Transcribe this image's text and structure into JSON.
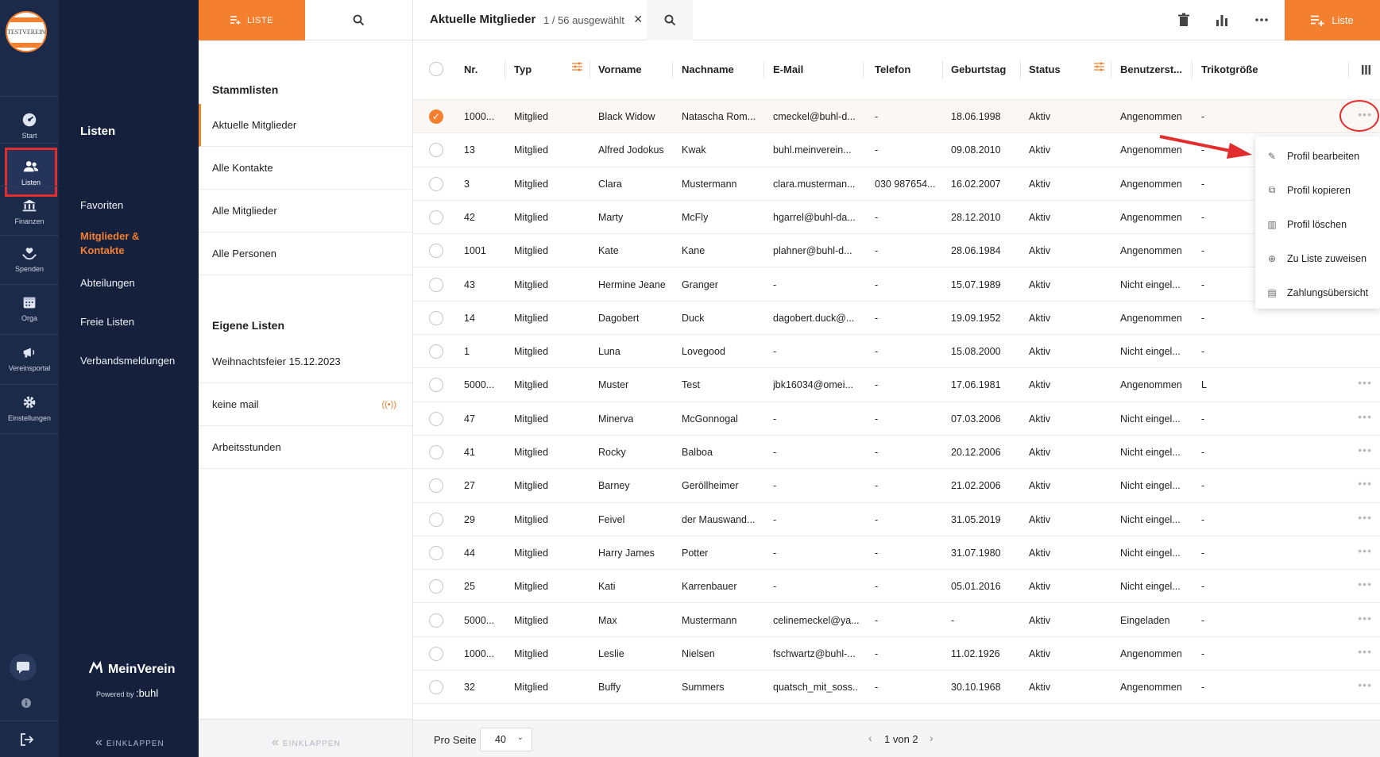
{
  "club_logo_text": "TESTVEREIN",
  "rail": {
    "items": [
      {
        "label": "Start",
        "icon": "dashboard-icon"
      },
      {
        "label": "Listen",
        "icon": "users-icon"
      },
      {
        "label": "Finanzen",
        "icon": "bank-icon"
      },
      {
        "label": "Spenden",
        "icon": "donation-icon"
      },
      {
        "label": "Orga",
        "icon": "calendar-icon"
      },
      {
        "label": "Vereinsportal",
        "icon": "megaphone-icon"
      },
      {
        "label": "Einstellungen",
        "icon": "gear-icon"
      }
    ]
  },
  "nav": {
    "title": "Listen",
    "items": [
      "Favoriten",
      "Mitglieder & Kontakte",
      "Abteilungen",
      "Freie Listen",
      "Verbandsmeldungen"
    ],
    "brand": "MeinVerein",
    "powered_prefix": "Powered by",
    "powered_brand": ":buhl",
    "collapse": "EINKLAPPEN"
  },
  "lists": {
    "tab_label": "LISTE",
    "section1": "Stammlisten",
    "stamm": [
      "Aktuelle Mitglieder",
      "Alle Kontakte",
      "Alle Mitglieder",
      "Alle Personen"
    ],
    "section2": "Eigene Listen",
    "eigene": [
      "Weihnachtsfeier 15.12.2023",
      "keine mail",
      "Arbeitsstunden"
    ],
    "broadcast_symbol": "((•))",
    "collapse": "EINKLAPPEN"
  },
  "main": {
    "title": "Aktuelle Mitglieder",
    "selection": "1 / 56 ausgewählt",
    "new_list_label": "Liste",
    "columns": [
      "Nr.",
      "Typ",
      "Vorname",
      "Nachname",
      "E-Mail",
      "Telefon",
      "Geburtstag",
      "Status",
      "Benutzerst...",
      "Trikotgröße"
    ],
    "rows": [
      [
        "1000...",
        "Mitglied",
        "Black Widow",
        "Natascha Rom...",
        "cmeckel@buhl-d...",
        "-",
        "18.06.1998",
        "Aktiv",
        "Angenommen",
        "-"
      ],
      [
        "13",
        "Mitglied",
        "Alfred Jodokus",
        "Kwak",
        "buhl.meinverein...",
        "-",
        "09.08.2010",
        "Aktiv",
        "Angenommen",
        "-"
      ],
      [
        "3",
        "Mitglied",
        "Clara",
        "Mustermann",
        "clara.musterman...",
        "030 987654...",
        "16.02.2007",
        "Aktiv",
        "Angenommen",
        "-"
      ],
      [
        "42",
        "Mitglied",
        "Marty",
        "McFly",
        "hgarrel@buhl-da...",
        "-",
        "28.12.2010",
        "Aktiv",
        "Angenommen",
        "-"
      ],
      [
        "1001",
        "Mitglied",
        "Kate",
        "Kane",
        "plahner@buhl-d...",
        "-",
        "28.06.1984",
        "Aktiv",
        "Angenommen",
        "-"
      ],
      [
        "43",
        "Mitglied",
        "Hermine Jeane",
        "Granger",
        "-",
        "-",
        "15.07.1989",
        "Aktiv",
        "Nicht eingel...",
        "-"
      ],
      [
        "14",
        "Mitglied",
        "Dagobert",
        "Duck",
        "dagobert.duck@...",
        "-",
        "19.09.1952",
        "Aktiv",
        "Angenommen",
        "-"
      ],
      [
        "1",
        "Mitglied",
        "Luna",
        "Lovegood",
        "-",
        "-",
        "15.08.2000",
        "Aktiv",
        "Nicht eingel...",
        "-"
      ],
      [
        "5000...",
        "Mitglied",
        "Muster",
        "Test",
        "jbk16034@omei...",
        "-",
        "17.06.1981",
        "Aktiv",
        "Angenommen",
        "L"
      ],
      [
        "47",
        "Mitglied",
        "Minerva",
        "McGonnogal",
        "-",
        "-",
        "07.03.2006",
        "Aktiv",
        "Nicht eingel...",
        "-"
      ],
      [
        "41",
        "Mitglied",
        "Rocky",
        "Balboa",
        "-",
        "-",
        "20.12.2006",
        "Aktiv",
        "Nicht eingel...",
        "-"
      ],
      [
        "27",
        "Mitglied",
        "Barney",
        "Geröllheimer",
        "-",
        "-",
        "21.02.2006",
        "Aktiv",
        "Nicht eingel...",
        "-"
      ],
      [
        "29",
        "Mitglied",
        "Feivel",
        "der Mauswand...",
        "-",
        "-",
        "31.05.2019",
        "Aktiv",
        "Nicht eingel...",
        "-"
      ],
      [
        "44",
        "Mitglied",
        "Harry James",
        "Potter",
        "-",
        "-",
        "31.07.1980",
        "Aktiv",
        "Nicht eingel...",
        "-"
      ],
      [
        "25",
        "Mitglied",
        "Kati",
        "Karrenbauer",
        "-",
        "-",
        "05.01.2016",
        "Aktiv",
        "Nicht eingel...",
        "-"
      ],
      [
        "5000...",
        "Mitglied",
        "Max",
        "Mustermann",
        "celinemeckel@ya...",
        "-",
        "-",
        "Aktiv",
        "Eingeladen",
        "-"
      ],
      [
        "1000...",
        "Mitglied",
        "Leslie",
        "Nielsen",
        "fschwartz@buhl-...",
        "-",
        "11.02.1926",
        "Aktiv",
        "Angenommen",
        "-"
      ],
      [
        "32",
        "Mitglied",
        "Buffy",
        "Summers",
        "quatsch_mit_soss...",
        "-",
        "30.10.1968",
        "Aktiv",
        "Angenommen",
        "-"
      ]
    ],
    "selected_row": 0,
    "context_menu": [
      {
        "label": "Profil bearbeiten",
        "icon": "pencil-icon"
      },
      {
        "label": "Profil kopieren",
        "icon": "copy-icon"
      },
      {
        "label": "Profil löschen",
        "icon": "trash-icon"
      },
      {
        "label": "Zu Liste zuweisen",
        "icon": "plus-circle-icon"
      },
      {
        "label": "Zahlungsübersicht",
        "icon": "receipt-icon"
      }
    ],
    "pager": {
      "per_page_label": "Pro Seite",
      "per_page": "40",
      "page_text": "1 von 2"
    }
  },
  "colors": {
    "accent": "#f47f2f",
    "rail": "#1c2a4a",
    "nav": "#15203d",
    "highlight": "#e12d2d"
  }
}
